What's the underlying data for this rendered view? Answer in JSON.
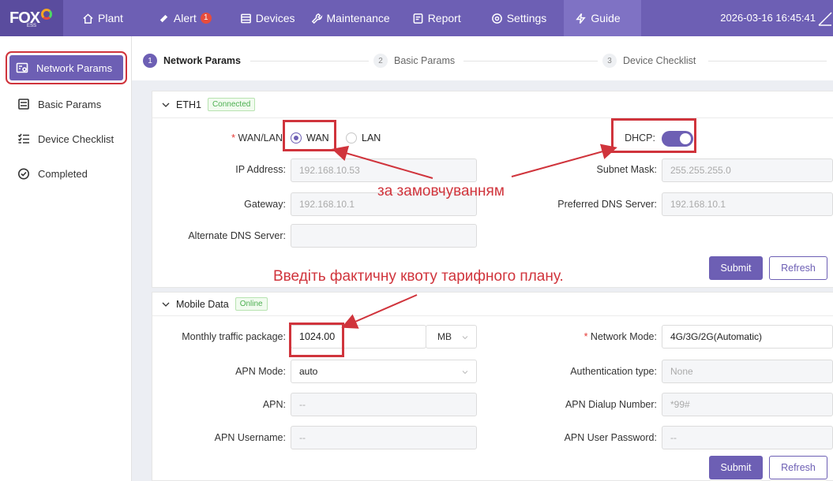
{
  "topbar": {
    "logo_text": "FOX",
    "logo_sub": "ESS",
    "nav": [
      {
        "label": "Plant",
        "icon": "home-icon"
      },
      {
        "label": "Alert",
        "icon": "bell-icon",
        "badge": "1"
      },
      {
        "label": "Devices",
        "icon": "devices-icon"
      },
      {
        "label": "Maintenance",
        "icon": "wrench-icon"
      },
      {
        "label": "Report",
        "icon": "report-icon"
      },
      {
        "label": "Settings",
        "icon": "gear-icon"
      },
      {
        "label": "Guide",
        "icon": "lightning-icon"
      }
    ],
    "datetime": "2026-03-16 16:45:41"
  },
  "sidebar": {
    "items": [
      {
        "label": "Network Params",
        "icon": "network-icon"
      },
      {
        "label": "Basic Params",
        "icon": "sliders-icon"
      },
      {
        "label": "Device Checklist",
        "icon": "checklist-icon"
      },
      {
        "label": "Completed",
        "icon": "check-circle-icon"
      }
    ]
  },
  "steps": [
    {
      "num": "1",
      "label": "Network Params"
    },
    {
      "num": "2",
      "label": "Basic Params"
    },
    {
      "num": "3",
      "label": "Device Checklist"
    }
  ],
  "eth1": {
    "title": "ETH1",
    "status": "Connected",
    "wanlan_label": "WAN/LAN",
    "wan_option": "WAN",
    "lan_option": "LAN",
    "dhcp_label": "DHCP",
    "ip_label": "IP Address",
    "ip_value": "192.168.10.53",
    "subnet_label": "Subnet Mask",
    "subnet_value": "255.255.255.0",
    "gateway_label": "Gateway",
    "gateway_value": "192.168.10.1",
    "pdns_label": "Preferred DNS Server",
    "pdns_value": "192.168.10.1",
    "adns_label": "Alternate DNS Server",
    "adns_value": "",
    "submit": "Submit",
    "refresh": "Refresh"
  },
  "mobile": {
    "title": "Mobile Data",
    "status": "Online",
    "traffic_label": "Monthly traffic package",
    "traffic_value": "1024.00",
    "traffic_unit": "MB",
    "network_mode_label": "Network Mode",
    "network_mode_value": "4G/3G/2G(Automatic)",
    "apn_mode_label": "APN Mode",
    "apn_mode_value": "auto",
    "auth_label": "Authentication type",
    "auth_value": "None",
    "apn_label": "APN",
    "apn_value": "--",
    "dial_label": "APN Dialup Number",
    "dial_value": "*99#",
    "user_label": "APN Username",
    "user_value": "--",
    "pass_label": "APN User Password",
    "pass_value": "--",
    "submit": "Submit",
    "refresh": "Refresh"
  },
  "annotations": {
    "default_note": "за замовчуванням",
    "quota_note": "Введіть фактичну квоту тарифного плану."
  }
}
